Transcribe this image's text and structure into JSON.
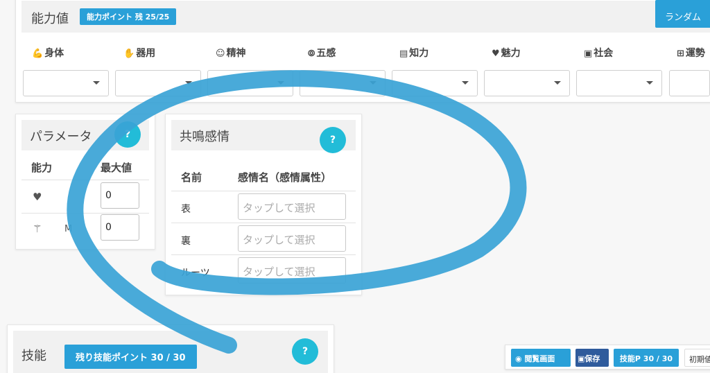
{
  "ability": {
    "title": "能力値",
    "points_badge": "能力ポイント 残 25/25",
    "random_button": "ランダム",
    "stats": [
      {
        "icon": "arm-icon",
        "glyph": "💪",
        "label": "身体"
      },
      {
        "icon": "hand-icon",
        "glyph": "✋",
        "label": "器用"
      },
      {
        "icon": "face-icon",
        "glyph": "☺",
        "label": "精神"
      },
      {
        "icon": "ear-icon",
        "glyph": "⦾",
        "label": "五感"
      },
      {
        "icon": "book-icon",
        "glyph": "▤",
        "label": "知力"
      },
      {
        "icon": "heart-icon",
        "glyph": "♥",
        "label": "魅力"
      },
      {
        "icon": "id-card-icon",
        "glyph": "▣",
        "label": "社会"
      },
      {
        "icon": "grid-icon",
        "glyph": "⊞",
        "label": "運勢"
      }
    ]
  },
  "parameter": {
    "title": "パラメータ",
    "help": "?",
    "col_ability": "能力",
    "col_max": "最大値",
    "rows": [
      {
        "icon": "heart-icon",
        "glyph": "♥",
        "short": "",
        "value": "0"
      },
      {
        "icon": "magic-wand-icon",
        "glyph": "⚚",
        "short": "M",
        "value": "0"
      }
    ]
  },
  "resonance": {
    "title": "共鳴感情",
    "help": "?",
    "col_name": "名前",
    "col_emotion": "感情名（感情属性）",
    "rows": [
      {
        "label": "表",
        "placeholder": "タップして選択"
      },
      {
        "label": "裏",
        "placeholder": "タップして選択"
      },
      {
        "label": "ルーツ",
        "placeholder": "タップして選択"
      }
    ]
  },
  "skill": {
    "title": "技能",
    "badge": "残り技能ポイント 30 / 30",
    "help": "?"
  },
  "toolbar": {
    "view_label": "閲覧画面",
    "save_label": "保存",
    "skill_points": "技能P 30 / 30",
    "init_label": "初期値"
  },
  "colors": {
    "accent": "#2aa0d8",
    "help": "#22bcd8",
    "save": "#2f5b9c",
    "stroke": "#3aa3d6"
  }
}
